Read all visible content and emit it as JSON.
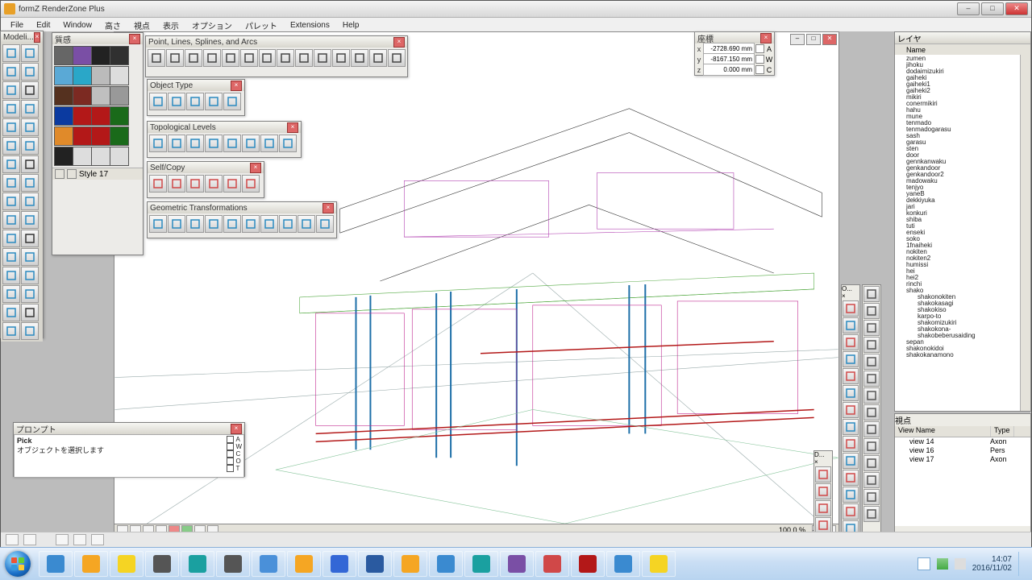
{
  "app": {
    "title": "formZ RenderZone Plus"
  },
  "menu": [
    "File",
    "Edit",
    "Window",
    "高さ",
    "視点",
    "表示",
    "オプション",
    "パレット",
    "Extensions",
    "Help"
  ],
  "palettes": {
    "modeling": {
      "title": "Modeli..."
    },
    "materials": {
      "title": "質感",
      "style_label": "Style 17",
      "swatches": [
        "#666",
        "#7a4fa5",
        "#222",
        "#303030",
        "#5aa9d6",
        "#2aa7c8",
        "#bbb",
        "#ddd",
        "#55311f",
        "#7c2a22",
        "#bfbfbf",
        "#999",
        "#0b3aa0",
        "#b31818",
        "#b31818",
        "#1a6a1a",
        "#e08a2a",
        "#b31818",
        "#b31818",
        "#1a6a1a",
        "#222",
        "#ddd",
        "#ddd",
        "#ddd"
      ]
    },
    "point_lines": {
      "title": "Point, Lines, Splines, and Arcs"
    },
    "object_type": {
      "title": "Object Type"
    },
    "topo": {
      "title": "Topological Levels"
    },
    "selfcopy": {
      "title": "Self/Copy"
    },
    "geom": {
      "title": "Geometric Transformations"
    }
  },
  "coords": {
    "title": "座標",
    "rows": [
      {
        "axis": "x",
        "value": "-2728.690 mm",
        "flag": "A"
      },
      {
        "axis": "y",
        "value": "-8167.150 mm",
        "flag": "W"
      },
      {
        "axis": "z",
        "value": "0.000 mm",
        "flag": "C"
      }
    ]
  },
  "prompt": {
    "title": "プロンプト",
    "line1": "Pick",
    "line2": "オブジェクトを選択します",
    "opts": [
      "A",
      "W",
      "C",
      "O",
      "T"
    ]
  },
  "layers_panel": {
    "title": "レイヤ",
    "header": "Name",
    "items": [
      "zumen",
      "jihoku",
      "dodaimizukiri",
      "gaiheki",
      "gaiheki1",
      "gaiheki2",
      "mikiri",
      "conermikiri",
      "hahu",
      "mune",
      "tenmado",
      "tenmadogarasu",
      "sash",
      "garasu",
      "sten",
      "door",
      "gennkanwaku",
      "genkandoor",
      "genkandoor2",
      "madowaku",
      "tenjyo",
      "yaneB",
      "dekkiyuka",
      "jari",
      "konkuri",
      "shiba",
      "tuti",
      "enseki",
      "soko",
      "1fnaiheki",
      "nokiten",
      "nokiten2",
      "humissi",
      "hei",
      "hei2",
      "rinchi",
      "shako"
    ],
    "sub": [
      "shakonokiten",
      "shakokasagi",
      "shakokiso",
      "karpo-to",
      "shakomizukiri",
      "shakokona-",
      "shakobeberusaiding"
    ],
    "tail": [
      "sepan",
      "shakonokidoi",
      "shakokanamono"
    ]
  },
  "views_panel": {
    "title": "視点",
    "cols": [
      "View Name",
      "Type"
    ],
    "rows": [
      {
        "name": "view 14",
        "type": "Axon"
      },
      {
        "name": "view 16",
        "type": "Pers"
      },
      {
        "name": "view 17",
        "type": "Axon"
      }
    ]
  },
  "viewport": {
    "zoom": "100.0 %"
  },
  "vstrip1": {
    "title": "O..."
  },
  "vstrip2": {
    "title": "D..."
  },
  "clock": {
    "time": "14:07",
    "date": "2016/11/02"
  }
}
